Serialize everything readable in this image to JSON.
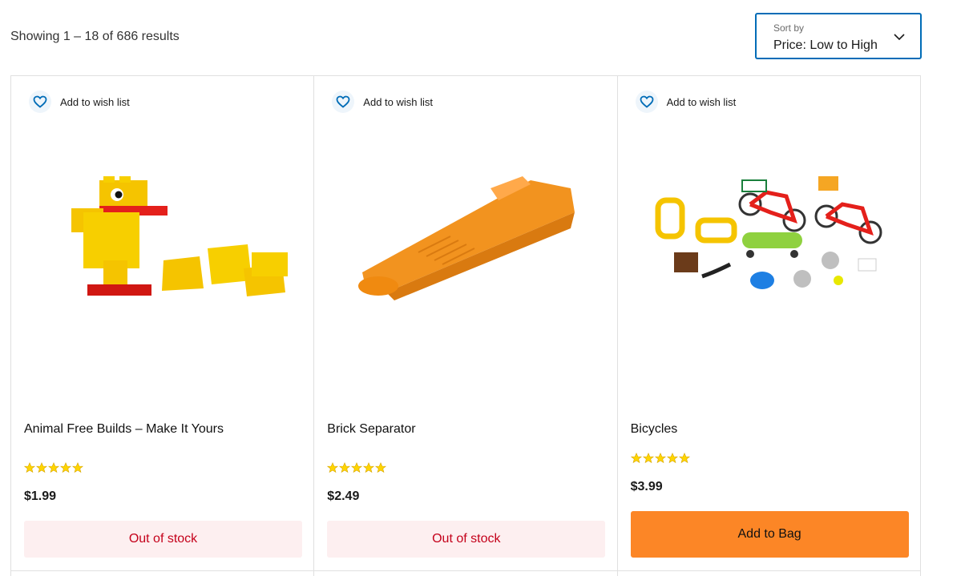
{
  "results": {
    "text": "Showing 1 – 18 of 686 results"
  },
  "sort": {
    "label": "Sort by",
    "value": "Price: Low to High"
  },
  "wishlist_label": "Add to wish list",
  "products": [
    {
      "name": "Animal Free Builds – Make It Yours",
      "price": "$1.99",
      "rating": 5,
      "status": "Out of stock",
      "image": "yellow-duck-brick-build"
    },
    {
      "name": "Brick Separator",
      "price": "$2.49",
      "rating": 5,
      "status": "Out of stock",
      "image": "orange-brick-separator"
    },
    {
      "name": "Bicycles",
      "price": "$3.99",
      "rating": 5,
      "action": "Add to Bag",
      "image": "bicycles-accessory-pack"
    }
  ],
  "colors": {
    "accent_blue": "#006cb7",
    "out_of_stock_text": "#c4001a",
    "add_to_bag_bg": "#fc8626",
    "star": "#ffd500"
  }
}
